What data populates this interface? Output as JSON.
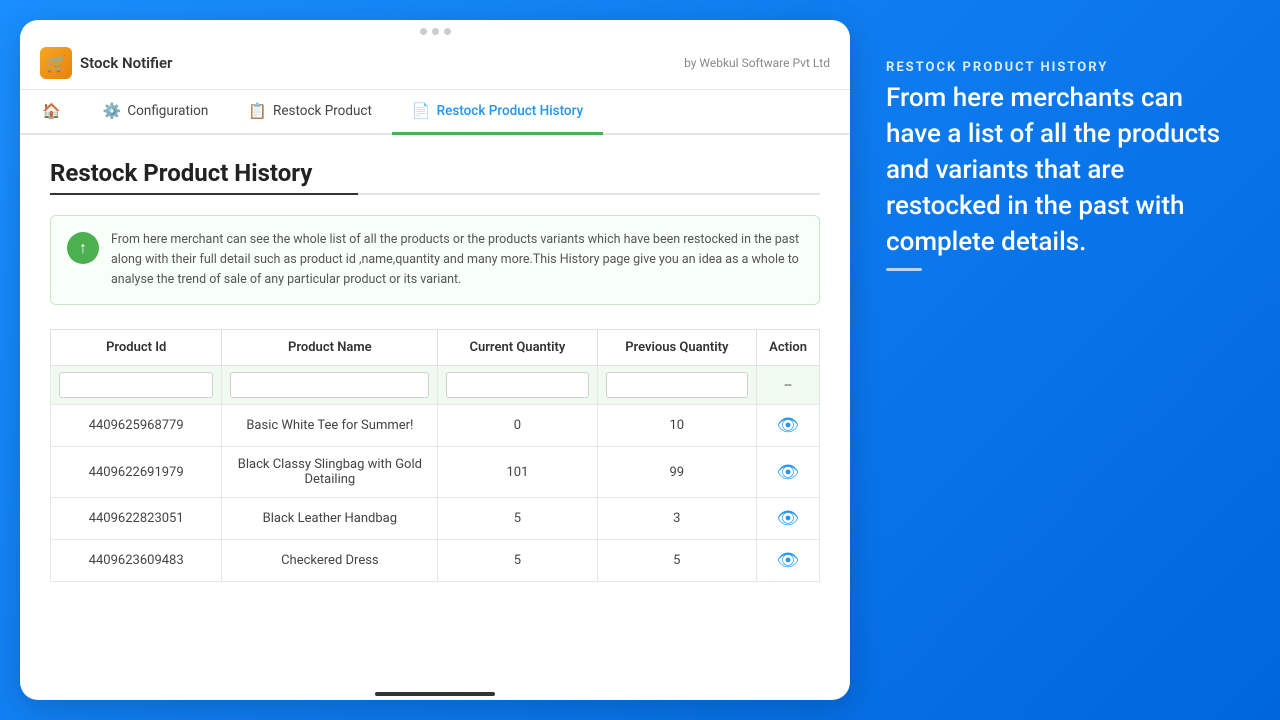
{
  "brand": {
    "name": "Stock Notifier",
    "by": "by Webkul Software Pvt Ltd",
    "icon": "🛒"
  },
  "nav": {
    "tabs": [
      {
        "id": "home",
        "label": "",
        "icon": "🏠",
        "active": false
      },
      {
        "id": "configuration",
        "label": "Configuration",
        "icon": "⚙️",
        "active": false
      },
      {
        "id": "restock-product",
        "label": "Restock Product",
        "icon": "📋",
        "active": false
      },
      {
        "id": "restock-history",
        "label": "Restock Product History",
        "icon": "📄",
        "active": true
      }
    ]
  },
  "page": {
    "title": "Restock Product History",
    "info_text": "From here merchant can see the whole list of all the products or the products variants which have been restocked in the past along with their full detail such as product id ,name,quantity and many more.This History page give you an idea as a whole to analyse the trend of sale of any particular product or its variant."
  },
  "table": {
    "columns": [
      "Product Id",
      "Product Name",
      "Current Quantity",
      "Previous Quantity",
      "Action"
    ],
    "filter_placeholder": "",
    "rows": [
      {
        "id": "4409625968779",
        "name": "Basic White Tee for Summer!",
        "current_qty": "0",
        "previous_qty": "10"
      },
      {
        "id": "4409622691979",
        "name": "Black Classy Slingbag with Gold Detailing",
        "current_qty": "101",
        "previous_qty": "99"
      },
      {
        "id": "4409622823051",
        "name": "Black Leather Handbag",
        "current_qty": "5",
        "previous_qty": "3"
      },
      {
        "id": "4409623609483",
        "name": "Checkered Dress",
        "current_qty": "5",
        "previous_qty": "5"
      }
    ],
    "filter_action_placeholder": "--"
  },
  "right_panel": {
    "label": "RESTOCK PRODUCT HISTORY",
    "description": "From here merchants can have a list of all the products and variants that are restocked in the past with complete details."
  }
}
